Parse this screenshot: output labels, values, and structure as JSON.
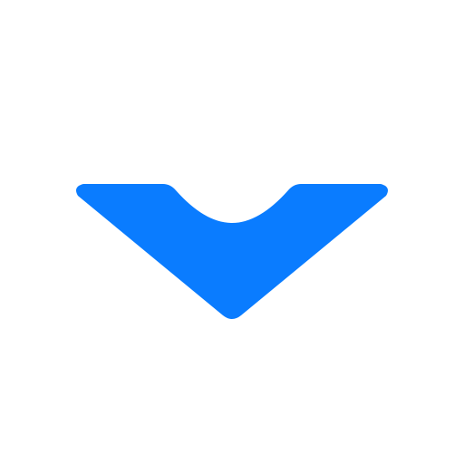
{
  "icon": {
    "name": "chevron-down-icon",
    "color": "#0a7cff"
  },
  "background": {
    "color": "#ffffff"
  }
}
